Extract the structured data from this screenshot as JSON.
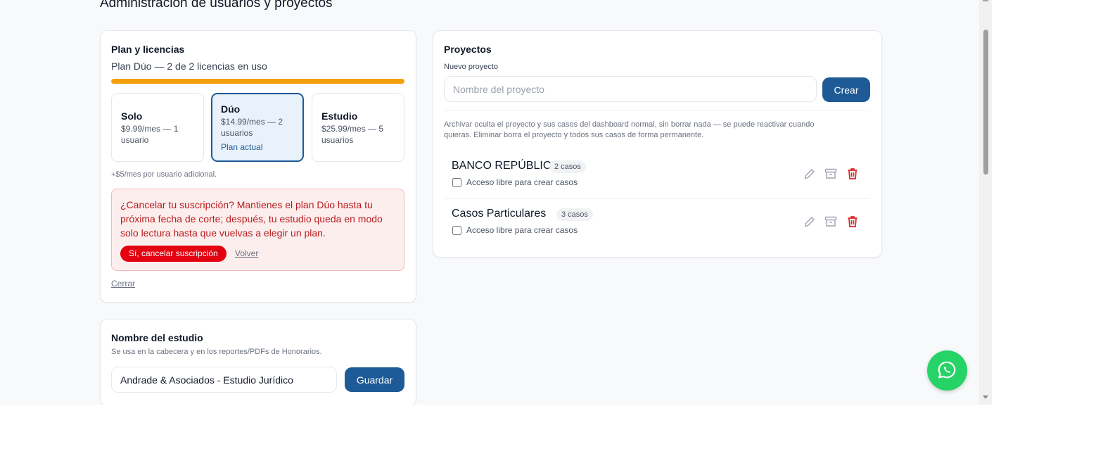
{
  "page": {
    "title": "Administración de usuarios y proyectos"
  },
  "plan": {
    "title": "Plan y licencias",
    "summary": "Plan Dúo — 2 de 2 licencias en uso",
    "licenses_used": 2,
    "licenses_total": 2,
    "progress_color": "#f59e0b",
    "options": [
      {
        "name": "Solo",
        "price": "$9.99/mes — 1 usuario"
      },
      {
        "name": "Dúo",
        "price": "$14.99/mes — 2 usuarios",
        "current_label": "Plan actual"
      },
      {
        "name": "Estudio",
        "price": "$25.99/mes — 5 usuarios"
      }
    ],
    "extra_user_note": "+$5/mes por usuario adicional.",
    "cancel_prompt": "¿Cancelar tu suscripción? Mantienes el plan Dúo hasta tu próxima fecha de corte; después, tu estudio queda en modo solo lectura hasta que vuelvas a elegir un plan.",
    "cancel_confirm_label": "Sí, cancelar suscripción",
    "back_label": "Volver",
    "close_label": "Cerrar"
  },
  "studio": {
    "title": "Nombre del estudio",
    "description": "Se usa en la cabecera y en los reportes/PDFs de Honorarios.",
    "name_value": "Andrade & Asociados - Estudio Jurídico",
    "save_label": "Guardar"
  },
  "projects": {
    "title": "Proyectos",
    "new_label": "Nuevo proyecto",
    "name_placeholder": "Nombre del proyecto",
    "create_label": "Crear",
    "help_line1": "Archivar oculta el proyecto y sus casos del dashboard normal, sin borrar nada — se puede reactivar cuando",
    "help_line2": "quieras. Eliminar borra el proyecto y todos sus casos de forma permanente.",
    "items": [
      {
        "name": "BANCO REPÚBLICA",
        "badge": "2 casos",
        "free_access_label": "Acceso libre para crear casos",
        "free_access": false
      },
      {
        "name": "Casos Particulares",
        "badge": "3 casos",
        "free_access_label": "Acceso libre para crear casos",
        "free_access": false
      }
    ]
  },
  "colors": {
    "primary": "#1e5a96",
    "danger": "#e3000f",
    "whatsapp": "#25d366"
  }
}
